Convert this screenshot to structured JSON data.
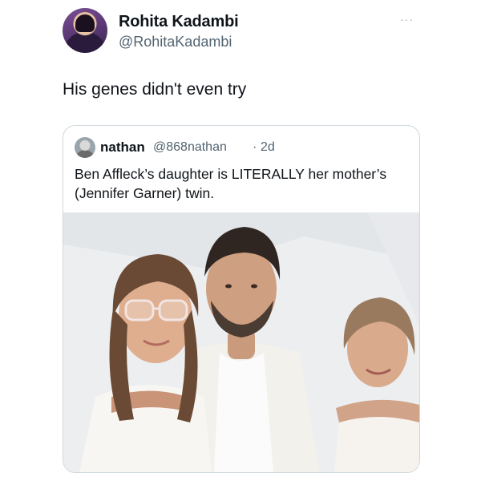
{
  "tweet": {
    "author_name": "Rohita Kadambi",
    "author_handle": "@RohitaKadambi",
    "text": "His genes didn't even try",
    "more_glyph": "···"
  },
  "quote": {
    "author_name": "nathan",
    "author_handle": "@868nathan",
    "separator": "·",
    "time": "2d",
    "text": "Ben Affleck’s daughter is LITERALLY her mother’s (Jennifer Garner) twin."
  },
  "icons": {
    "more": "more-horizontal-icon"
  }
}
